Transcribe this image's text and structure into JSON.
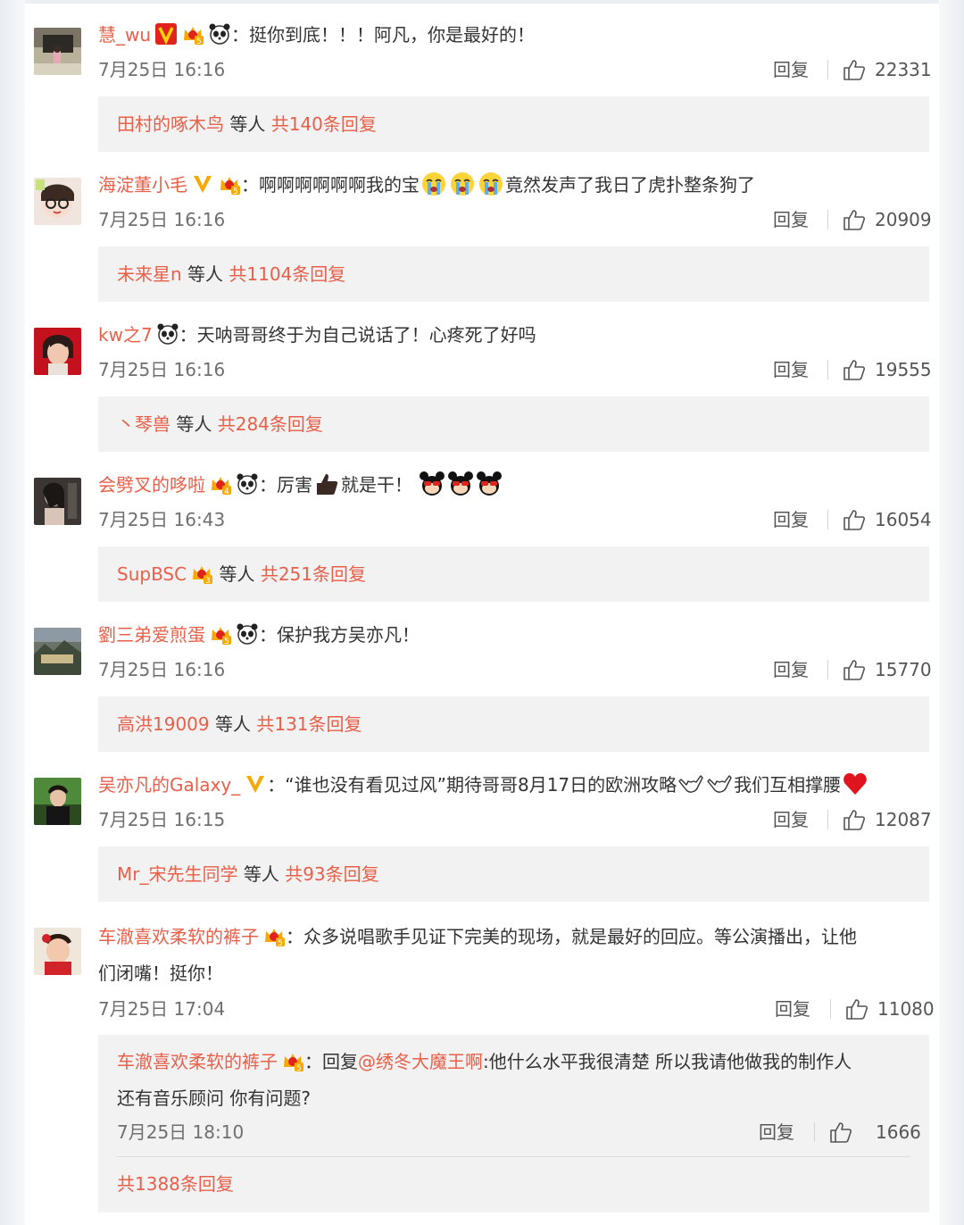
{
  "ui": {
    "reply_label": "回复",
    "etc_label": "等人"
  },
  "comments": [
    {
      "username": "慧_wu",
      "text": "挺你到底！！！阿凡，你是最好的！",
      "time": "7月25日 16:16",
      "likes": "22331",
      "reply_user": "田村的啄木鸟",
      "reply_total": "共140条回复"
    },
    {
      "username": "海淀董小毛",
      "text_before": "啊啊啊啊啊啊我的宝",
      "text_after": "竟然发声了我日了虎扑整条狗了",
      "time": "7月25日 16:16",
      "likes": "20909",
      "reply_user": "未来星n",
      "reply_total": "共1104条回复"
    },
    {
      "username": "kw之7",
      "text": "天呐哥哥终于为自己说话了！心疼死了好吗",
      "time": "7月25日 16:16",
      "likes": "19555",
      "reply_user": "丶琴兽",
      "reply_total": "共284条回复"
    },
    {
      "username": "会劈叉的哆啦",
      "text_before": "厉害",
      "text_after": "就是干！",
      "time": "7月25日 16:43",
      "likes": "16054",
      "reply_user": "SupBSC",
      "reply_total": "共251条回复"
    },
    {
      "username": "劉三弟爱煎蛋",
      "text": "保护我方吴亦凡！",
      "time": "7月25日 16:16",
      "likes": "15770",
      "reply_user": "高洪19009",
      "reply_total": "共131条回复"
    },
    {
      "username": "吴亦凡的Galaxy_",
      "text_before": "“谁也没有看见过风”期待哥哥8月17日的欧洲攻略",
      "text_after": "我们互相撑腰",
      "time": "7月25日 16:15",
      "likes": "12087",
      "reply_user": "Mr_宋先生同学",
      "reply_total": "共93条回复"
    },
    {
      "username": "车澈喜欢柔软的裤子",
      "text_line1": "众多说唱歌手见证下完美的现场，就是最好的回应。等公演播出，让他",
      "text_line2": "们闭嘴！挺你！",
      "time": "7月25日 17:04",
      "likes": "11080"
    }
  ],
  "sub_reply": {
    "username": "车澈喜欢柔软的裤子",
    "prefix": "回复",
    "mention": "@绣冬大魔王啊",
    "text_line1": ":他什么水平我很清楚 所以我请他做我的制作人",
    "text_line2": "还有音乐顾问 你有问题?",
    "time": "7月25日 18:10",
    "likes": "1666",
    "total": "共1388条回复"
  },
  "colors": {
    "username": "#e8604a",
    "reply_box_bg": "#f2f2f2",
    "vip_orange": "#f7a900",
    "vip_red": "#e0231b"
  }
}
